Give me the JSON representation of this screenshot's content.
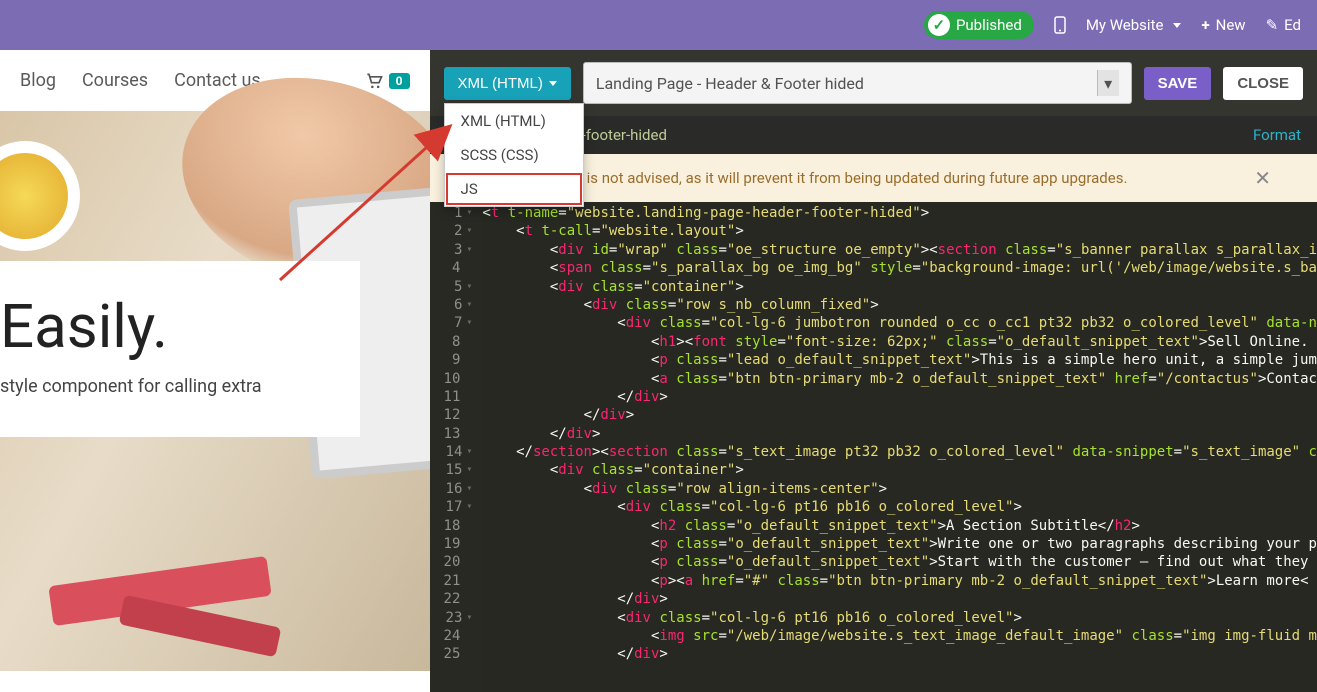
{
  "topbar": {
    "published_label": "Published",
    "website_label": "My Website",
    "new_label": "New",
    "edit_label": "Ed"
  },
  "site_nav": {
    "items": [
      "Blog",
      "Courses",
      "Contact us"
    ],
    "cart_count": "0"
  },
  "hero": {
    "title": "Easily.",
    "subtitle": "style component for calling extra"
  },
  "editor_toolbar": {
    "xml_button": "XML (HTML)",
    "template_selected": "Landing Page - Header & Footer hided",
    "save": "SAVE",
    "close": "CLOSE"
  },
  "dropdown_options": [
    "XML (HTML)",
    "SCSS (CSS)",
    "JS"
  ],
  "highlighted_option_index": 2,
  "editor_header": {
    "template_id": "landing-page-header-footer-hided",
    "format": "Format"
  },
  "warning_text": "le through this editor is not advised, as it will prevent it from being updated during future app upgrades.",
  "code_lines": [
    {
      "n": 1,
      "fold": true,
      "indent": 0,
      "html": "<span class='bracket'>&lt;</span><span class='tag'>t</span> <span class='attr'>t-name</span>=<span class='val'>\"website.landing-page-header-footer-hided\"</span><span class='bracket'>&gt;</span>"
    },
    {
      "n": 2,
      "fold": true,
      "indent": 1,
      "html": "<span class='bracket'>&lt;</span><span class='tag'>t</span> <span class='attr'>t-call</span>=<span class='val'>\"website.layout\"</span><span class='bracket'>&gt;</span>"
    },
    {
      "n": 3,
      "fold": true,
      "indent": 2,
      "html": "<span class='bracket'>&lt;</span><span class='tag'>div</span> <span class='attr'>id</span>=<span class='val'>\"wrap\"</span> <span class='attr'>class</span>=<span class='val'>\"oe_structure oe_empty\"</span><span class='bracket'>&gt;&lt;</span><span class='tag'>section</span> <span class='attr'>class</span>=<span class='val'>\"s_banner parallax s_parallax_i</span>"
    },
    {
      "n": 4,
      "fold": false,
      "indent": 2,
      "html": "<span class='bracket'>&lt;</span><span class='tag'>span</span> <span class='attr'>class</span>=<span class='val'>\"s_parallax_bg oe_img_bg\"</span> <span class='attr'>style</span>=<span class='val'>\"background-image: url('/web/image/website.s_ba</span>"
    },
    {
      "n": 5,
      "fold": true,
      "indent": 2,
      "html": "<span class='bracket'>&lt;</span><span class='tag'>div</span> <span class='attr'>class</span>=<span class='val'>\"container\"</span><span class='bracket'>&gt;</span>"
    },
    {
      "n": 6,
      "fold": true,
      "indent": 3,
      "html": "<span class='bracket'>&lt;</span><span class='tag'>div</span> <span class='attr'>class</span>=<span class='val'>\"row s_nb_column_fixed\"</span><span class='bracket'>&gt;</span>"
    },
    {
      "n": 7,
      "fold": true,
      "indent": 4,
      "html": "<span class='bracket'>&lt;</span><span class='tag'>div</span> <span class='attr'>class</span>=<span class='val'>\"col-lg-6 jumbotron rounded o_cc o_cc1 pt32 pb32 o_colored_level\"</span> <span class='attr'>data-n</span>"
    },
    {
      "n": 8,
      "fold": false,
      "indent": 5,
      "html": "<span class='bracket'>&lt;</span><span class='tag'>h1</span><span class='bracket'>&gt;&lt;</span><span class='tag'>font</span> <span class='attr'>style</span>=<span class='val'>\"font-size: 62px;\"</span> <span class='attr'>class</span>=<span class='val'>\"o_default_snippet_text\"</span><span class='bracket'>&gt;</span><span class='txt'>Sell Online.</span>"
    },
    {
      "n": 9,
      "fold": false,
      "indent": 5,
      "html": "<span class='bracket'>&lt;</span><span class='tag'>p</span> <span class='attr'>class</span>=<span class='val'>\"lead o_default_snippet_text\"</span><span class='bracket'>&gt;</span><span class='txt'>This is a simple hero unit, a simple jum</span>"
    },
    {
      "n": 10,
      "fold": false,
      "indent": 5,
      "html": "<span class='bracket'>&lt;</span><span class='tag'>a</span> <span class='attr'>class</span>=<span class='val'>\"btn btn-primary mb-2 o_default_snippet_text\"</span> <span class='attr'>href</span>=<span class='val'>\"/contactus\"</span><span class='bracket'>&gt;</span><span class='txt'>Contac</span>"
    },
    {
      "n": 11,
      "fold": false,
      "indent": 4,
      "html": "<span class='bracket'>&lt;/</span><span class='tag'>div</span><span class='bracket'>&gt;</span>"
    },
    {
      "n": 12,
      "fold": false,
      "indent": 3,
      "html": "<span class='bracket'>&lt;/</span><span class='tag'>div</span><span class='bracket'>&gt;</span>"
    },
    {
      "n": 13,
      "fold": false,
      "indent": 2,
      "html": "<span class='bracket'>&lt;/</span><span class='tag'>div</span><span class='bracket'>&gt;</span>"
    },
    {
      "n": 14,
      "fold": true,
      "indent": 1,
      "html": "<span class='bracket'>&lt;/</span><span class='tag'>section</span><span class='bracket'>&gt;&lt;</span><span class='tag'>section</span> <span class='attr'>class</span>=<span class='val'>\"s_text_image pt32 pb32 o_colored_level\"</span> <span class='attr'>data-snippet</span>=<span class='val'>\"s_text_image\"</span> <span class='attr'>c</span>"
    },
    {
      "n": 15,
      "fold": true,
      "indent": 2,
      "html": "<span class='bracket'>&lt;</span><span class='tag'>div</span> <span class='attr'>class</span>=<span class='val'>\"container\"</span><span class='bracket'>&gt;</span>"
    },
    {
      "n": 16,
      "fold": true,
      "indent": 3,
      "html": "<span class='bracket'>&lt;</span><span class='tag'>div</span> <span class='attr'>class</span>=<span class='val'>\"row align-items-center\"</span><span class='bracket'>&gt;</span>"
    },
    {
      "n": 17,
      "fold": true,
      "indent": 4,
      "html": "<span class='bracket'>&lt;</span><span class='tag'>div</span> <span class='attr'>class</span>=<span class='val'>\"col-lg-6 pt16 pb16 o_colored_level\"</span><span class='bracket'>&gt;</span>"
    },
    {
      "n": 18,
      "fold": false,
      "indent": 5,
      "html": "<span class='bracket'>&lt;</span><span class='tag'>h2</span> <span class='attr'>class</span>=<span class='val'>\"o_default_snippet_text\"</span><span class='bracket'>&gt;</span><span class='txt'>A Section Subtitle</span><span class='bracket'>&lt;/</span><span class='tag'>h2</span><span class='bracket'>&gt;</span>"
    },
    {
      "n": 19,
      "fold": false,
      "indent": 5,
      "html": "<span class='bracket'>&lt;</span><span class='tag'>p</span> <span class='attr'>class</span>=<span class='val'>\"o_default_snippet_text\"</span><span class='bracket'>&gt;</span><span class='txt'>Write one or two paragraphs describing your p</span>"
    },
    {
      "n": 20,
      "fold": false,
      "indent": 5,
      "html": "<span class='bracket'>&lt;</span><span class='tag'>p</span> <span class='attr'>class</span>=<span class='val'>\"o_default_snippet_text\"</span><span class='bracket'>&gt;</span><span class='txt'>Start with the customer – find out what they</span>"
    },
    {
      "n": 21,
      "fold": false,
      "indent": 5,
      "html": "<span class='bracket'>&lt;</span><span class='tag'>p</span><span class='bracket'>&gt;&lt;</span><span class='tag'>a</span> <span class='attr'>href</span>=<span class='val'>\"#\"</span> <span class='attr'>class</span>=<span class='val'>\"btn btn-primary mb-2 o_default_snippet_text\"</span><span class='bracket'>&gt;</span><span class='txt'>Learn more</span><span class='bracket'>&lt;</span>"
    },
    {
      "n": 22,
      "fold": false,
      "indent": 4,
      "html": "<span class='bracket'>&lt;/</span><span class='tag'>div</span><span class='bracket'>&gt;</span>"
    },
    {
      "n": 23,
      "fold": true,
      "indent": 4,
      "html": "<span class='bracket'>&lt;</span><span class='tag'>div</span> <span class='attr'>class</span>=<span class='val'>\"col-lg-6 pt16 pb16 o_colored_level\"</span><span class='bracket'>&gt;</span>"
    },
    {
      "n": 24,
      "fold": false,
      "indent": 5,
      "html": "<span class='bracket'>&lt;</span><span class='tag'>img</span> <span class='attr'>src</span>=<span class='val'>\"/web/image/website.s_text_image_default_image\"</span> <span class='attr'>class</span>=<span class='val'>\"img img-fluid m</span>"
    },
    {
      "n": 25,
      "fold": false,
      "indent": 4,
      "html": "<span class='bracket'>&lt;/</span><span class='tag'>div</span><span class='bracket'>&gt;</span>"
    }
  ]
}
